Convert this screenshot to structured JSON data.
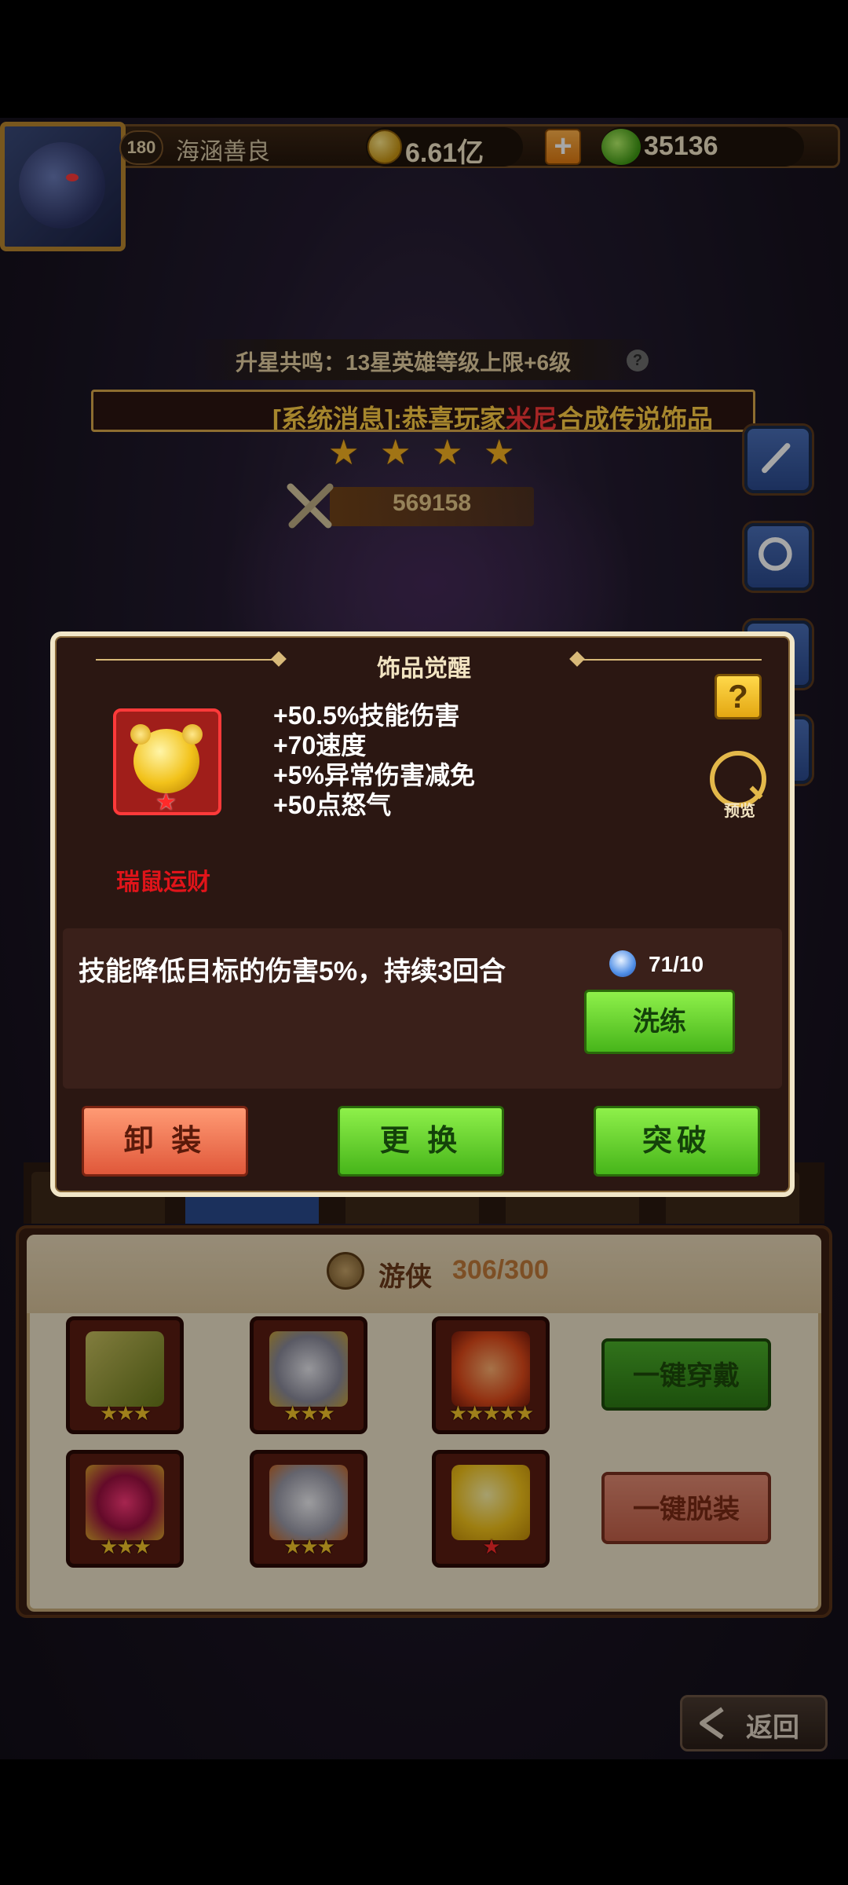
{
  "topbar": {
    "level": "180",
    "player_name": "海涵善良",
    "coins": "6.61亿",
    "plus": "+",
    "gems": "35136"
  },
  "hero": {
    "resonance": "升星共鸣：13星英雄等级上限+6级",
    "help": "?",
    "broadcast_prefix": "[系统消息]:恭喜玩家",
    "broadcast_player": "米尼",
    "broadcast_suffix": "合成传说饰品",
    "star_count": 4,
    "power": "569158"
  },
  "modal": {
    "title": "饰品觉醒",
    "help": "?",
    "preview_label": "预览",
    "item_name": "瑞鼠运财",
    "stats": [
      "+50.5%技能伤害",
      "+70速度",
      "+5%异常伤害减免",
      "+50点怒气"
    ],
    "skill_description": "技能降低目标的伤害5%，持续3回合",
    "stone_count": "71/10",
    "refine_label": "洗练",
    "unequip_label": "卸 装",
    "replace_label": "更 换",
    "breakthrough_label": "突破"
  },
  "equipment": {
    "class_label": "游侠",
    "class_count": "306/300",
    "equip_all_label": "一键穿戴",
    "unequip_all_label": "一键脱装",
    "slots": [
      {
        "name": "weapon-slot",
        "stars": "★★★"
      },
      {
        "name": "helmet-slot",
        "stars": "★★★"
      },
      {
        "name": "gem-slot",
        "stars": "★★★★★"
      },
      {
        "name": "ring-slot",
        "stars": "★★★"
      },
      {
        "name": "armor-slot",
        "stars": "★★★"
      },
      {
        "name": "accessory-slot",
        "stars": "★"
      }
    ]
  },
  "nav": {
    "back_label": "返回"
  }
}
